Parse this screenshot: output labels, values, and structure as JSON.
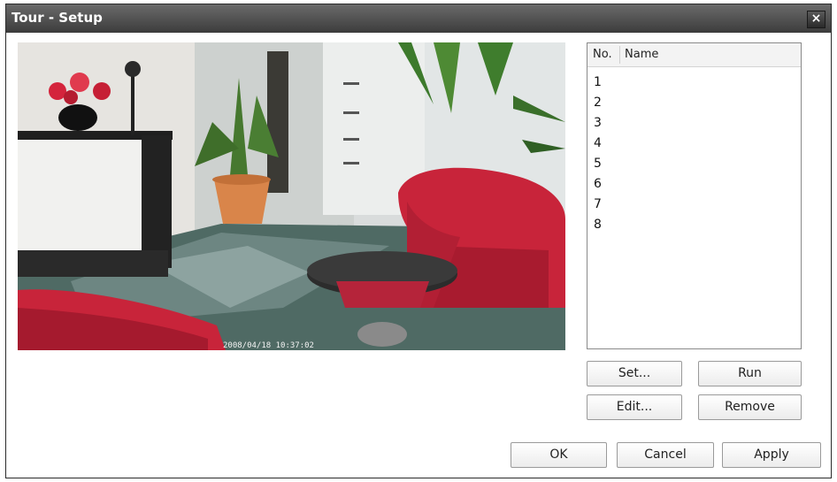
{
  "window": {
    "title": "Tour - Setup",
    "close_glyph": "×"
  },
  "preview": {
    "timestamp": "2008/04/18 10:37:02",
    "image_description_icon": "camera-preview"
  },
  "tour_list": {
    "columns": {
      "no": "No.",
      "name": "Name"
    },
    "rows": [
      {
        "no": "1",
        "name": ""
      },
      {
        "no": "2",
        "name": ""
      },
      {
        "no": "3",
        "name": ""
      },
      {
        "no": "4",
        "name": ""
      },
      {
        "no": "5",
        "name": ""
      },
      {
        "no": "6",
        "name": ""
      },
      {
        "no": "7",
        "name": ""
      },
      {
        "no": "8",
        "name": ""
      }
    ]
  },
  "buttons": {
    "set": "Set...",
    "run": "Run",
    "edit": "Edit...",
    "remove": "Remove",
    "ok": "OK",
    "cancel": "Cancel",
    "apply": "Apply"
  },
  "colors": {
    "titlebar": "#4a4a4a",
    "chair_red": "#c8243a"
  }
}
